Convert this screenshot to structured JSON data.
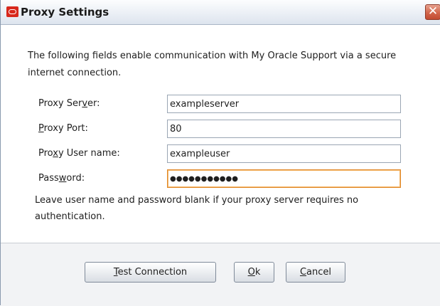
{
  "window": {
    "title": "Proxy Settings",
    "close_glyph": "✕"
  },
  "intro_text": "The following fields enable communication with My Oracle Support via a secure internet connection.",
  "fields": {
    "proxy_server": {
      "label_before": "Proxy Ser",
      "label_mnemonic": "v",
      "label_after": "er:",
      "value": "exampleserver"
    },
    "proxy_port": {
      "label_before": "",
      "label_mnemonic": "P",
      "label_after": "roxy Port:",
      "value": "80"
    },
    "proxy_user": {
      "label_before": "Pro",
      "label_mnemonic": "x",
      "label_after": "y User name:",
      "value": "exampleuser"
    },
    "password": {
      "label_before": "Pass",
      "label_mnemonic": "w",
      "label_after": "ord:",
      "masked_value": "●●●●●●●●●●●"
    }
  },
  "note_text": "Leave user name and password blank if your proxy server requires no authentication.",
  "buttons": {
    "test_connection": {
      "mnemonic": "T",
      "rest": "est Connection"
    },
    "ok": {
      "mnemonic": "O",
      "rest": "k"
    },
    "cancel": {
      "mnemonic": "C",
      "rest": "ancel"
    }
  },
  "colors": {
    "oracle_red": "#d8281c",
    "focus_orange": "#e0882a"
  },
  "icons": {
    "app": "oracle-logo-icon",
    "close": "close-icon"
  }
}
